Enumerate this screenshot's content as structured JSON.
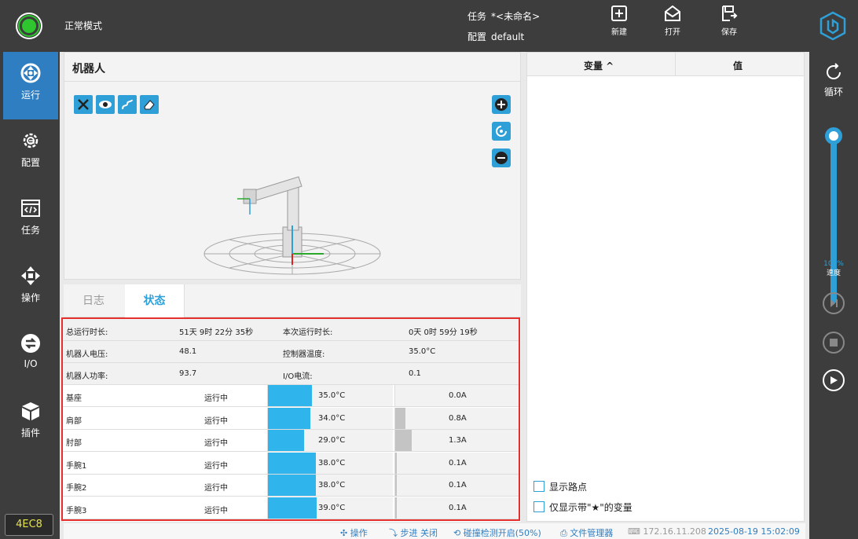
{
  "topbar": {
    "mode": "正常模式",
    "task_label": "任务",
    "task_value": "*<未命名>",
    "config_label": "配置",
    "config_value": "default",
    "new_label": "新建",
    "open_label": "打开",
    "save_label": "保存"
  },
  "sidebar": {
    "items": [
      {
        "label": "运行",
        "icon": "run-icon"
      },
      {
        "label": "配置",
        "icon": "gear-icon"
      },
      {
        "label": "任务",
        "icon": "code-window-icon"
      },
      {
        "label": "操作",
        "icon": "move-arrows-icon"
      },
      {
        "label": "I/O",
        "icon": "io-arrows-icon"
      },
      {
        "label": "插件",
        "icon": "cube-icon"
      }
    ],
    "version": "4EC8"
  },
  "right": {
    "loop_label": "循环",
    "speed_percent": "100%",
    "speed_label": "速度",
    "speed_level": 1.0
  },
  "robot": {
    "title": "机器人"
  },
  "tabs": [
    "日志",
    "状态"
  ],
  "status": {
    "summary": [
      {
        "k1": "总运行时长:",
        "v1": "51天 9时 22分 35秒",
        "k2": "本次运行时长:",
        "v2": "0天 0时 59分 19秒"
      },
      {
        "k1": "机器人电压:",
        "v1": "48.1",
        "k2": "控制器温度:",
        "v2": "35.0°C"
      },
      {
        "k1": "机器人功率:",
        "v1": "93.7",
        "k2": "I/O电流:",
        "v2": "0.1"
      }
    ],
    "joints": [
      {
        "name": "基座",
        "state": "运行中",
        "temp": "35.0°C",
        "temp_frac": 0.35,
        "current": "0.0A",
        "cur_frac": 0.0
      },
      {
        "name": "肩部",
        "state": "运行中",
        "temp": "34.0°C",
        "temp_frac": 0.34,
        "current": "0.8A",
        "cur_frac": 0.08
      },
      {
        "name": "肘部",
        "state": "运行中",
        "temp": "29.0°C",
        "temp_frac": 0.29,
        "current": "1.3A",
        "cur_frac": 0.13
      },
      {
        "name": "手腕1",
        "state": "运行中",
        "temp": "38.0°C",
        "temp_frac": 0.38,
        "current": "0.1A",
        "cur_frac": 0.01
      },
      {
        "name": "手腕2",
        "state": "运行中",
        "temp": "38.0°C",
        "temp_frac": 0.38,
        "current": "0.1A",
        "cur_frac": 0.01
      },
      {
        "name": "手腕3",
        "state": "运行中",
        "temp": "39.0°C",
        "temp_frac": 0.39,
        "current": "0.1A",
        "cur_frac": 0.01
      }
    ]
  },
  "variables": {
    "col_var": "变量 ^",
    "col_val": "值",
    "show_waypoints": "显示路点",
    "show_starred": "仅显示带\"★\"的变量"
  },
  "statusbar": {
    "op": "操作",
    "step": "步进 关闭",
    "collision": "碰撞检测开启(50%)",
    "filemgr": "文件管理器",
    "ip": "172.16.11.208",
    "datetime": "2025-08-19 15:02:09"
  },
  "colors": {
    "accent": "#2f9fd8",
    "power_on": "#2ec52e",
    "highlight_border": "#e53030"
  }
}
